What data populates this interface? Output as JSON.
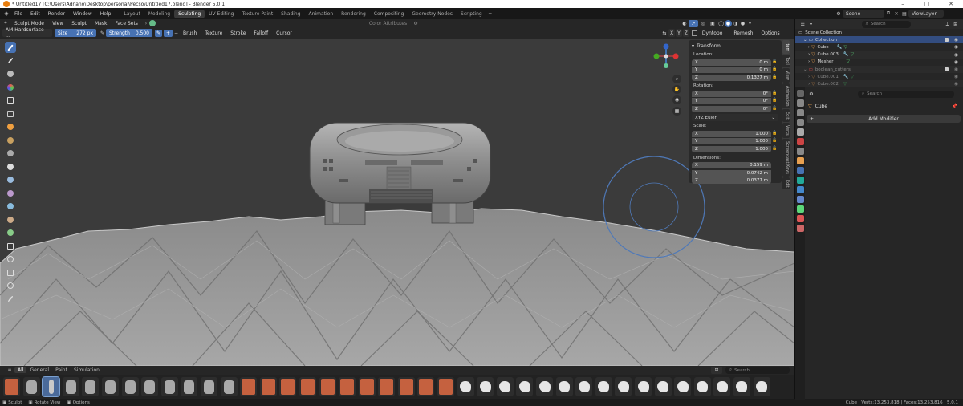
{
  "window": {
    "title": "* Untitled17 [C:\\Users\\Adnano\\Desktop\\personal\\Pecso\\Untitled17.blend] - Blender 5.0.1"
  },
  "menus": [
    "File",
    "Edit",
    "Render",
    "Window",
    "Help"
  ],
  "workspaces": [
    "Layout",
    "Modeling",
    "Sculpting",
    "UV Editing",
    "Texture Paint",
    "Shading",
    "Animation",
    "Rendering",
    "Compositing",
    "Geometry Nodes",
    "Scripting"
  ],
  "scene": {
    "name": "Scene",
    "view_layer": "ViewLayer"
  },
  "header_tools": {
    "mode": "Sculpt Mode",
    "view": "View",
    "sculpt": "Sculpt",
    "mask": "Mask",
    "face_sets": "Face Sets",
    "color_attributes": "Color Attributes"
  },
  "tool_settings": {
    "brush_name": "AM Hardsurface ...",
    "size_label": "Size",
    "size_value": "272 px",
    "strength_label": "Strength",
    "strength_value": "0.500",
    "dropdowns": [
      "Brush",
      "Texture",
      "Stroke",
      "Falloff",
      "Cursor"
    ],
    "dyntopo": "Dyntopo",
    "remesh": "Remesh",
    "options": "Options",
    "axis": [
      "X",
      "Y",
      "Z"
    ]
  },
  "transform_panel": {
    "header": "Transform",
    "location_label": "Location:",
    "location": [
      {
        "axis": "X",
        "value": "0 m"
      },
      {
        "axis": "Y",
        "value": "0 m"
      },
      {
        "axis": "Z",
        "value": "0.1327 m"
      }
    ],
    "rotation_label": "Rotation:",
    "rotation": [
      {
        "axis": "X",
        "value": "0°"
      },
      {
        "axis": "Y",
        "value": "0°"
      },
      {
        "axis": "Z",
        "value": "0°"
      }
    ],
    "rotation_mode": "XYZ Euler",
    "scale_label": "Scale:",
    "scale": [
      {
        "axis": "X",
        "value": "1.000"
      },
      {
        "axis": "Y",
        "value": "1.000"
      },
      {
        "axis": "Z",
        "value": "1.000"
      }
    ],
    "dimensions_label": "Dimensions:",
    "dimensions": [
      {
        "axis": "X",
        "value": "0.159 m"
      },
      {
        "axis": "Y",
        "value": "0.0742 m"
      },
      {
        "axis": "Z",
        "value": "0.0377 m"
      }
    ]
  },
  "n_tabs": [
    "Item",
    "Tool",
    "View",
    "Animation",
    "Edit",
    "Verts",
    "Screencast Keys",
    "Edit"
  ],
  "asset_shelf": {
    "tabs": [
      "All",
      "General",
      "Paint",
      "Simulation"
    ],
    "search_placeholder": "Search"
  },
  "outliner": {
    "search_placeholder": "Search",
    "scene_collection": "Scene Collection",
    "items": [
      {
        "name": "Collection",
        "indent": 0
      },
      {
        "name": "Cube",
        "indent": 1
      },
      {
        "name": "Cube.003",
        "indent": 1
      },
      {
        "name": "Mesher",
        "indent": 1
      },
      {
        "name": "boolean_cutters",
        "indent": 0
      },
      {
        "name": "Cube.001",
        "indent": 1
      },
      {
        "name": "Cube.002",
        "indent": 1
      }
    ]
  },
  "properties": {
    "search_placeholder": "Search",
    "object_name": "Cube",
    "add_modifier": "Add Modifier"
  },
  "statusbar": {
    "left": [
      "Sculpt",
      "Rotate View",
      "Options"
    ],
    "right": "Cube | Verts:13,253,818 | Faces:13,253,816 | 5.0.1"
  },
  "colors": {
    "accent": "#4772b3",
    "viewport": "#3b3b3b",
    "panel": "#262626"
  }
}
